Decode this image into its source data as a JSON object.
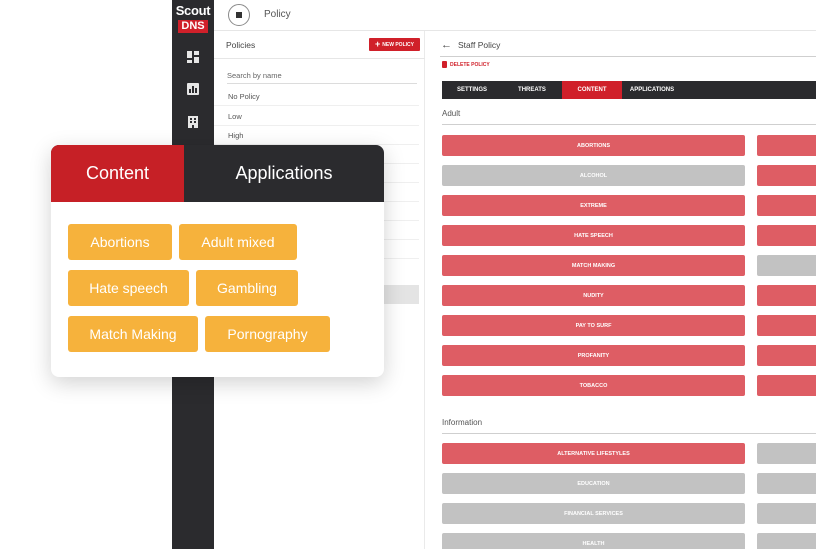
{
  "brand": {
    "line1": "Scout",
    "line2": "DNS"
  },
  "rail_icons": [
    "dashboard-icon",
    "bar-chart-icon",
    "building-icon"
  ],
  "topbar": {
    "title": "Policy"
  },
  "policies": {
    "heading": "Policies",
    "new_policy_label": "NEW POLICY",
    "search_placeholder": "Search by name",
    "items": [
      "No Policy",
      "Low",
      "High"
    ]
  },
  "policy_detail": {
    "title": "Staff Policy",
    "delete_label": "DELETE POLICY",
    "tabs": [
      "SETTINGS",
      "THREATS",
      "CONTENT",
      "APPLICATIONS"
    ],
    "active_tab": "CONTENT",
    "sections": [
      {
        "label": "Adult",
        "items": [
          {
            "name": "ABORTIONS",
            "blocked": true,
            "right_blocked": true
          },
          {
            "name": "ALCOHOL",
            "blocked": false,
            "right_blocked": true
          },
          {
            "name": "EXTREME",
            "blocked": true,
            "right_blocked": true
          },
          {
            "name": "HATE SPEECH",
            "blocked": true,
            "right_blocked": true
          },
          {
            "name": "MATCH MAKING",
            "blocked": true,
            "right_blocked": false
          },
          {
            "name": "NUDITY",
            "blocked": true,
            "right_blocked": true
          },
          {
            "name": "PAY TO SURF",
            "blocked": true,
            "right_blocked": true
          },
          {
            "name": "PROFANITY",
            "blocked": true,
            "right_blocked": true
          },
          {
            "name": "TOBACCO",
            "blocked": true,
            "right_blocked": true
          }
        ]
      },
      {
        "label": "Information",
        "items": [
          {
            "name": "ALTERNATIVE LIFESTYLES",
            "blocked": true,
            "right_blocked": false
          },
          {
            "name": "EDUCATION",
            "blocked": false,
            "right_blocked": false
          },
          {
            "name": "FINANCIAL SERVICES",
            "blocked": false,
            "right_blocked": false
          },
          {
            "name": "HEALTH",
            "blocked": false,
            "right_blocked": false
          }
        ]
      }
    ]
  },
  "card": {
    "tabs": [
      "Content",
      "Applications"
    ],
    "active_tab": "Content",
    "chips": [
      "Abortions",
      "Adult mixed",
      "Hate speech",
      "Gambling",
      "Match Making",
      "Pornography"
    ]
  },
  "colors": {
    "brand_red": "#d0202a",
    "dark": "#2b2b2e",
    "blocked": "#de5d64",
    "allowed": "#c2c2c2",
    "chip": "#f6b23c"
  }
}
